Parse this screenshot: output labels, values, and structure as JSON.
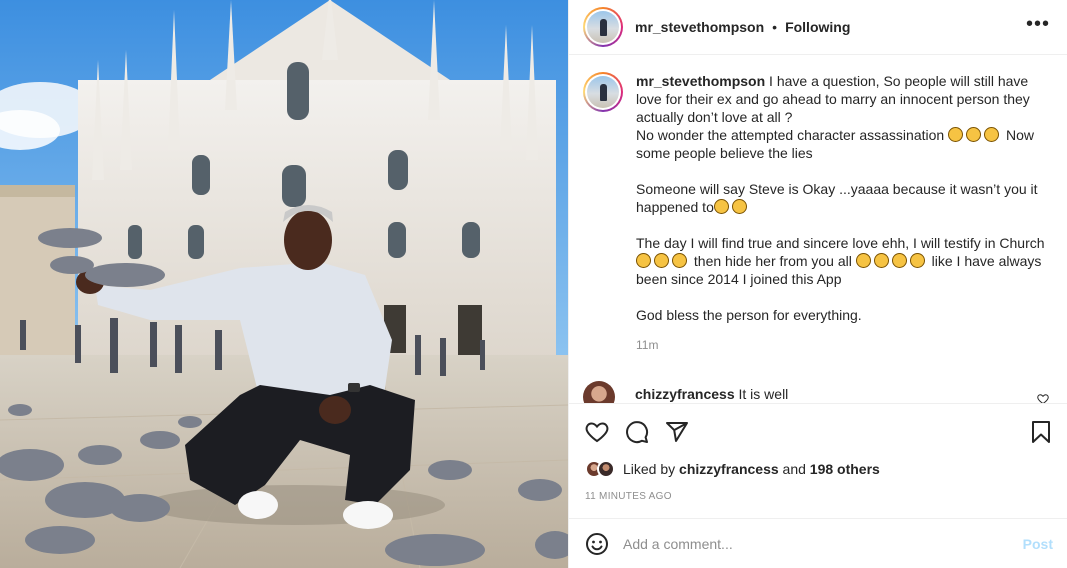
{
  "header": {
    "username": "mr_stevethompson",
    "separator": "•",
    "follow_status": "Following",
    "more_icon": "more-horizontal-icon"
  },
  "caption": {
    "username": "mr_stevethompson",
    "lines": [
      "I have a question, So people will still have love for their ex and go ahead to marry an innocent person they actually don’t love at all ?",
      "No wonder the attempted character assassination",
      "Now some people believe the lies",
      "Someone will say Steve is Okay ...yaaaa because it wasn’t you it happened to",
      "The day I will find true and sincere love ehh, I will testify in Church",
      "then hide her from you all",
      "like I have always been since 2014 I joined this App",
      "God bless the person for everything."
    ],
    "time_ago": "11m"
  },
  "comment": {
    "username": "chizzyfrancess",
    "text": "It is well",
    "like_icon": "heart-icon"
  },
  "actions": {
    "like_icon": "heart-icon",
    "comment_icon": "comment-bubble-icon",
    "share_icon": "paper-plane-icon",
    "save_icon": "bookmark-icon"
  },
  "likes": {
    "prefix": "Liked by",
    "user": "chizzyfrancess",
    "conjunction": "and",
    "others": "198 others"
  },
  "timestamp": "11 MINUTES AGO",
  "add_comment": {
    "placeholder": "Add a comment...",
    "post_label": "Post",
    "emoji_icon": "smiley-icon"
  },
  "colors": {
    "text": "#262626",
    "secondary": "#8e8e8e",
    "post_disabled": "#b2dffc",
    "border": "#efefef"
  }
}
